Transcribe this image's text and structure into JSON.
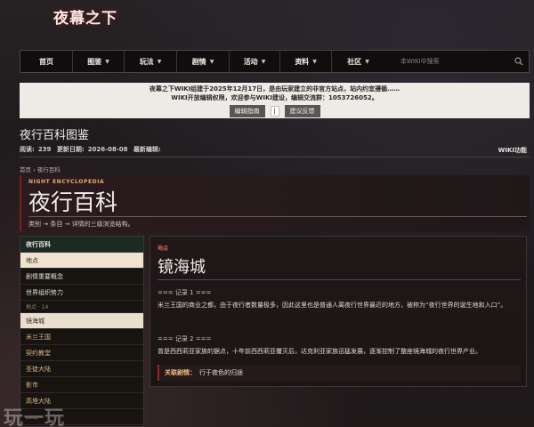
{
  "logo": {
    "text": "夜幕之下"
  },
  "nav": {
    "items": [
      {
        "label": "首页",
        "caret": false
      },
      {
        "label": "图鉴",
        "caret": true
      },
      {
        "label": "玩法",
        "caret": true
      },
      {
        "label": "剧情",
        "caret": true
      },
      {
        "label": "活动",
        "caret": true
      },
      {
        "label": "资料",
        "caret": true
      },
      {
        "label": "社区",
        "caret": true
      }
    ],
    "search_placeholder": "本WIKI中搜索"
  },
  "notice": {
    "line1": "夜幕之下WIKI组建于2025年12月17日，是由玩家建立的非官方站点，站内约宜遵循……",
    "line2": "WIKI开放编辑权限，欢迎参与WIKI建设，编辑交流群：1053726052。",
    "btn_guide": "编辑指南",
    "btn_sep": "|",
    "btn_feedback": "建议反馈"
  },
  "page": {
    "title": "夜行百科图鉴",
    "views_label": "阅读:",
    "views": "239",
    "updated_label": "更新日期:",
    "updated": "2026-08-08",
    "editor_label": "最新编辑:",
    "editor": "",
    "wiki_tools": "WIKI功能",
    "breadcrumb": "首页 › 夜行百科"
  },
  "encyclopedia": {
    "en_title": "NIGHT ENCYCLOPEDIA",
    "title": "夜行百科",
    "subtitle": "类别 → 条目 → 详情的三级浏览结构。"
  },
  "sidebar": {
    "header": "夜行百科",
    "items": [
      {
        "label": "地点",
        "kind": "active"
      },
      {
        "label": "剧情重要概念",
        "kind": "normal"
      },
      {
        "label": "世界组织势力",
        "kind": "normal"
      },
      {
        "label": "地点 · 14",
        "kind": "group"
      },
      {
        "label": "镜海城",
        "kind": "hot"
      },
      {
        "label": "米兰王国",
        "kind": "red"
      },
      {
        "label": "契约教堂",
        "kind": "red"
      },
      {
        "label": "圣徒大陆",
        "kind": "red"
      },
      {
        "label": "影市",
        "kind": "red"
      },
      {
        "label": "高塔大陆",
        "kind": "red"
      },
      {
        "label": "……",
        "kind": "red"
      }
    ]
  },
  "main": {
    "tag": "地点",
    "title": "镜海城",
    "record1": "=== 记录 1 ===",
    "para1": "米兰王国的商业之都，由于夜行者数量极多，因此这里也是普通人离夜行世界最近的地方，被称为“夜行世界的诞生地和入口”。",
    "record2": "=== 记录 2 ===",
    "para2": "曾是西西莉亚家族的据点，十年前西西莉亚覆灭后，达克利亚家族迅猛发展，逐渐控制了整座镜海城的夜行世界产业。",
    "related_label": "关联剧情：",
    "related_value": "行于夜色的归途"
  },
  "watermark": "玩一玩"
}
